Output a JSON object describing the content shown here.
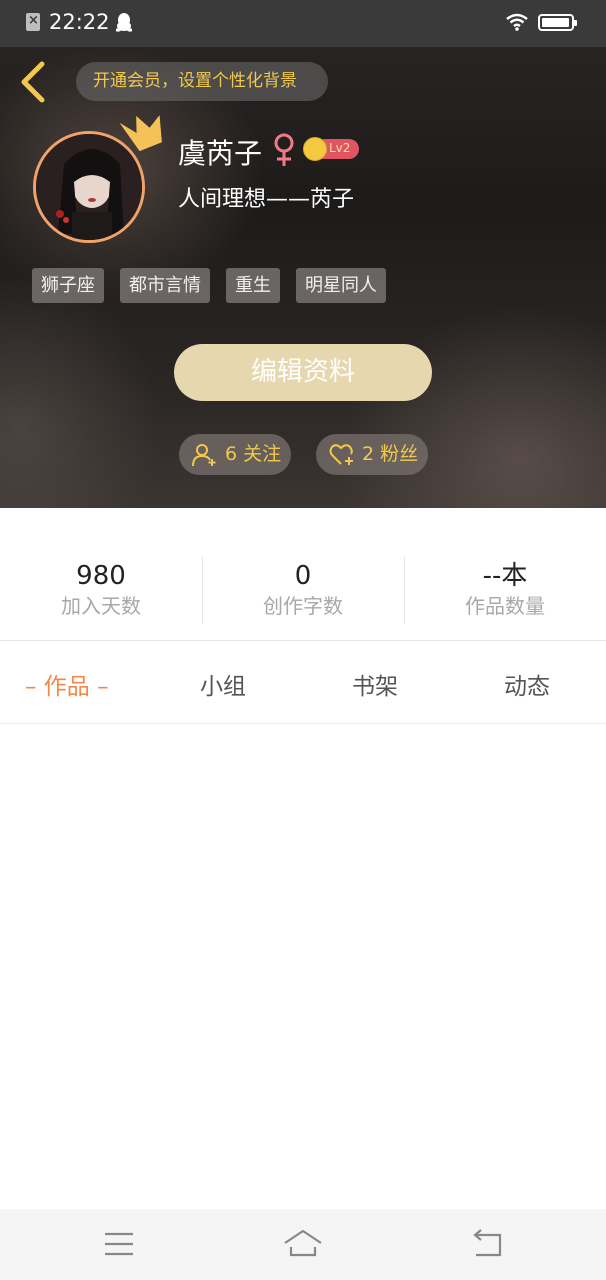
{
  "status_bar": {
    "time": "22:22"
  },
  "header": {
    "vip_banner": "开通会员，设置个性化背景"
  },
  "profile": {
    "name": "虞芮子",
    "gender_symbol": "♀",
    "level": "Lv2",
    "signature": "人间理想——芮子",
    "tags": [
      "狮子座",
      "都市言情",
      "重生",
      "明星同人"
    ],
    "edit_label": "编辑资料",
    "following_label": "6 关注",
    "followers_label": "2 粉丝"
  },
  "stats": [
    {
      "value": "980",
      "label": "加入天数"
    },
    {
      "value": "0",
      "label": "创作字数"
    },
    {
      "value": "--本",
      "label": "作品数量"
    }
  ],
  "tabs": [
    "– 作品 –",
    "小组",
    "书架",
    "动态"
  ],
  "colors": {
    "accent": "#f08a4b",
    "gold": "#f2c94c",
    "edit_button": "#e6d7ae"
  }
}
